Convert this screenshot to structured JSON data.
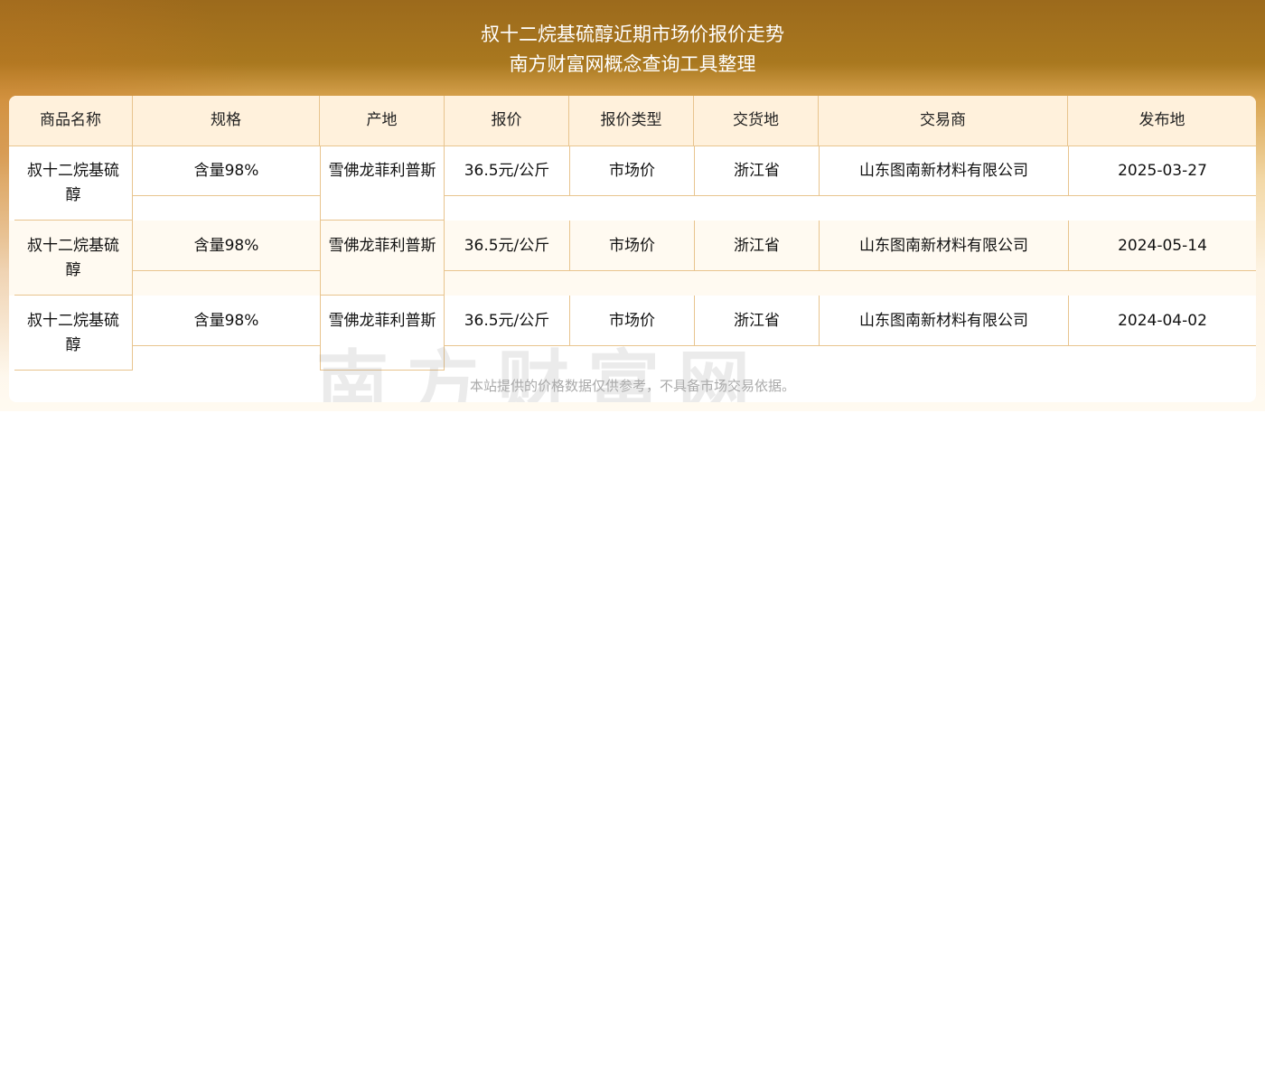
{
  "header": {
    "title": "叔十二烷基硫醇近期市场价报价走势",
    "subtitle": "南方财富网概念查询工具整理"
  },
  "columns": [
    "商品名称",
    "规格",
    "产地",
    "报价",
    "报价类型",
    "交货地",
    "交易商",
    "发布地"
  ],
  "rows": [
    [
      "叔十二烷基硫醇",
      "含量98%",
      "雪佛龙菲利普斯",
      "36.5元/公斤",
      "市场价",
      "浙江省",
      "山东图南新材料有限公司",
      "2025-03-27"
    ],
    [
      "叔十二烷基硫醇",
      "含量98%",
      "雪佛龙菲利普斯",
      "36.5元/公斤",
      "市场价",
      "浙江省",
      "山东图南新材料有限公司",
      "2024-05-14"
    ],
    [
      "叔十二烷基硫醇",
      "含量98%",
      "雪佛龙菲利普斯",
      "36.5元/公斤",
      "市场价",
      "浙江省",
      "山东图南新材料有限公司",
      "2024-04-02"
    ]
  ],
  "watermark": "南方财富网 southmoney.com",
  "note": "本站提供的价格数据仅供参考，不具备市场交易依据。"
}
